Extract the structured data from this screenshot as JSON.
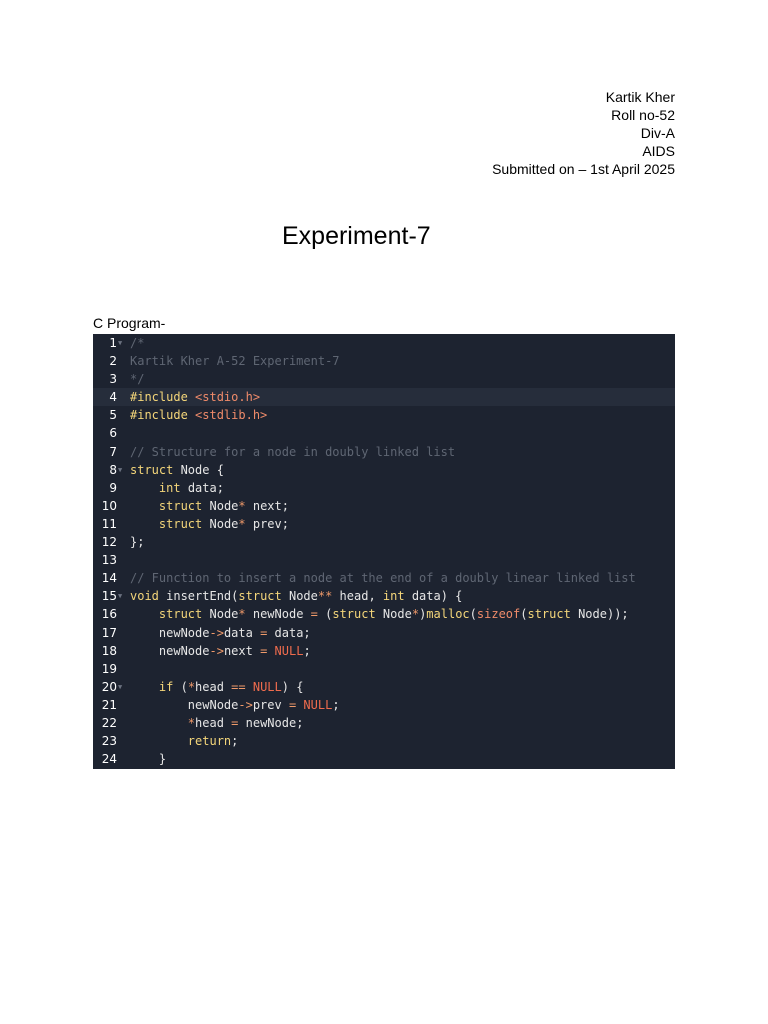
{
  "header": {
    "name": "Kartik Kher",
    "roll": "Roll no-52",
    "division": "Div-A",
    "branch": "AIDS",
    "submitted": "Submitted on – 1st April 2025"
  },
  "title": "Experiment-7",
  "section_label": "C Program-",
  "code": {
    "colors": {
      "background": "#1d2330",
      "comment": "#5f6673",
      "keyword": "#f4d67a",
      "string": "#ef8b6a",
      "constant": "#ee6b4d",
      "plain": "#e6e6e6"
    },
    "lines": [
      {
        "num": "1",
        "fold": true,
        "tokens": [
          {
            "t": "/*",
            "c": "comment"
          }
        ]
      },
      {
        "num": "2",
        "tokens": [
          {
            "t": "Kartik Kher A-52 Experiment-7",
            "c": "comment"
          }
        ]
      },
      {
        "num": "3",
        "tokens": [
          {
            "t": "*/",
            "c": "comment"
          }
        ]
      },
      {
        "num": "4",
        "active": true,
        "tokens": [
          {
            "t": "#include ",
            "c": "keyword"
          },
          {
            "t": "<stdio.h>",
            "c": "string"
          }
        ]
      },
      {
        "num": "5",
        "tokens": [
          {
            "t": "#include ",
            "c": "keyword"
          },
          {
            "t": "<stdlib.h>",
            "c": "string"
          }
        ]
      },
      {
        "num": "6",
        "tokens": []
      },
      {
        "num": "7",
        "tokens": [
          {
            "t": "// Structure for a node in doubly linked list",
            "c": "comment"
          }
        ]
      },
      {
        "num": "8",
        "fold": true,
        "tokens": [
          {
            "t": "struct",
            "c": "keyword"
          },
          {
            "t": " Node {",
            "c": "plain"
          }
        ]
      },
      {
        "num": "9",
        "tokens": [
          {
            "t": "    ",
            "c": "plain"
          },
          {
            "t": "int",
            "c": "keyword"
          },
          {
            "t": " data;",
            "c": "plain"
          }
        ]
      },
      {
        "num": "10",
        "tokens": [
          {
            "t": "    ",
            "c": "plain"
          },
          {
            "t": "struct",
            "c": "keyword"
          },
          {
            "t": " Node",
            "c": "plain"
          },
          {
            "t": "*",
            "c": "operator"
          },
          {
            "t": " next;",
            "c": "plain"
          }
        ]
      },
      {
        "num": "11",
        "tokens": [
          {
            "t": "    ",
            "c": "plain"
          },
          {
            "t": "struct",
            "c": "keyword"
          },
          {
            "t": " Node",
            "c": "plain"
          },
          {
            "t": "*",
            "c": "operator"
          },
          {
            "t": " prev;",
            "c": "plain"
          }
        ]
      },
      {
        "num": "12",
        "tokens": [
          {
            "t": "};",
            "c": "plain"
          }
        ]
      },
      {
        "num": "13",
        "tokens": []
      },
      {
        "num": "14",
        "tokens": [
          {
            "t": "// Function to insert a node at the end of a doubly linear linked list",
            "c": "comment"
          }
        ]
      },
      {
        "num": "15",
        "fold": true,
        "tokens": [
          {
            "t": "void",
            "c": "keyword"
          },
          {
            "t": " insertEnd(",
            "c": "plain"
          },
          {
            "t": "struct",
            "c": "keyword"
          },
          {
            "t": " Node",
            "c": "plain"
          },
          {
            "t": "**",
            "c": "operator"
          },
          {
            "t": " head, ",
            "c": "plain"
          },
          {
            "t": "int",
            "c": "keyword"
          },
          {
            "t": " data) {",
            "c": "plain"
          }
        ]
      },
      {
        "num": "16",
        "tokens": [
          {
            "t": "    ",
            "c": "plain"
          },
          {
            "t": "struct",
            "c": "keyword"
          },
          {
            "t": " Node",
            "c": "plain"
          },
          {
            "t": "*",
            "c": "operator"
          },
          {
            "t": " newNode ",
            "c": "plain"
          },
          {
            "t": "=",
            "c": "operator"
          },
          {
            "t": " (",
            "c": "plain"
          },
          {
            "t": "struct",
            "c": "keyword"
          },
          {
            "t": " Node",
            "c": "plain"
          },
          {
            "t": "*",
            "c": "operator"
          },
          {
            "t": ")",
            "c": "plain"
          },
          {
            "t": "malloc",
            "c": "func"
          },
          {
            "t": "(",
            "c": "plain"
          },
          {
            "t": "sizeof",
            "c": "string"
          },
          {
            "t": "(",
            "c": "plain"
          },
          {
            "t": "struct",
            "c": "keyword"
          },
          {
            "t": " Node));",
            "c": "plain"
          }
        ]
      },
      {
        "num": "17",
        "tokens": [
          {
            "t": "    newNode",
            "c": "plain"
          },
          {
            "t": "->",
            "c": "operator"
          },
          {
            "t": "data ",
            "c": "plain"
          },
          {
            "t": "=",
            "c": "operator"
          },
          {
            "t": " data;",
            "c": "plain"
          }
        ]
      },
      {
        "num": "18",
        "tokens": [
          {
            "t": "    newNode",
            "c": "plain"
          },
          {
            "t": "->",
            "c": "operator"
          },
          {
            "t": "next ",
            "c": "plain"
          },
          {
            "t": "=",
            "c": "operator"
          },
          {
            "t": " ",
            "c": "plain"
          },
          {
            "t": "NULL",
            "c": "const"
          },
          {
            "t": ";",
            "c": "plain"
          }
        ]
      },
      {
        "num": "19",
        "tokens": []
      },
      {
        "num": "20",
        "fold": true,
        "tokens": [
          {
            "t": "    ",
            "c": "plain"
          },
          {
            "t": "if",
            "c": "keyword"
          },
          {
            "t": " (",
            "c": "plain"
          },
          {
            "t": "*",
            "c": "operator"
          },
          {
            "t": "head ",
            "c": "plain"
          },
          {
            "t": "==",
            "c": "operator"
          },
          {
            "t": " ",
            "c": "plain"
          },
          {
            "t": "NULL",
            "c": "const"
          },
          {
            "t": ") {",
            "c": "plain"
          }
        ]
      },
      {
        "num": "21",
        "tokens": [
          {
            "t": "        newNode",
            "c": "plain"
          },
          {
            "t": "->",
            "c": "operator"
          },
          {
            "t": "prev ",
            "c": "plain"
          },
          {
            "t": "=",
            "c": "operator"
          },
          {
            "t": " ",
            "c": "plain"
          },
          {
            "t": "NULL",
            "c": "const"
          },
          {
            "t": ";",
            "c": "plain"
          }
        ]
      },
      {
        "num": "22",
        "tokens": [
          {
            "t": "        ",
            "c": "plain"
          },
          {
            "t": "*",
            "c": "operator"
          },
          {
            "t": "head ",
            "c": "plain"
          },
          {
            "t": "=",
            "c": "operator"
          },
          {
            "t": " newNode;",
            "c": "plain"
          }
        ]
      },
      {
        "num": "23",
        "tokens": [
          {
            "t": "        ",
            "c": "plain"
          },
          {
            "t": "return",
            "c": "keyword"
          },
          {
            "t": ";",
            "c": "plain"
          }
        ]
      },
      {
        "num": "24",
        "tokens": [
          {
            "t": "    }",
            "c": "plain"
          }
        ]
      }
    ]
  }
}
